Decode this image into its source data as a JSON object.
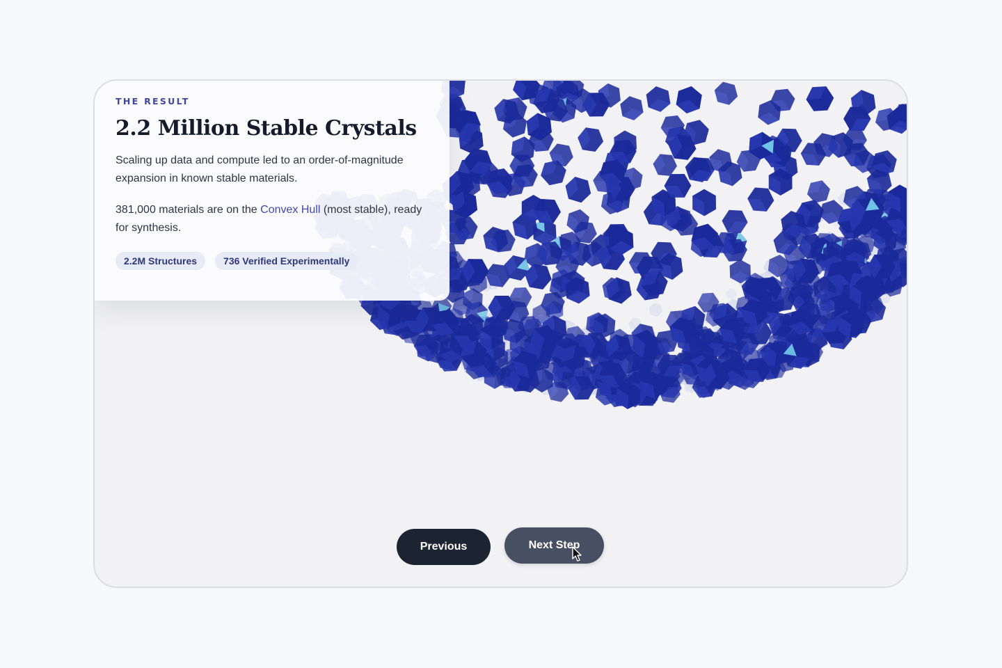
{
  "card": {
    "eyebrow": "THE RESULT",
    "title": "2.2 Million Stable Crystals",
    "paragraph1": "Scaling up data and compute led to an order-of-magnitude expansion in known stable materials.",
    "paragraph2_before": "381,000 materials are on the ",
    "paragraph2_link": "Convex Hull",
    "paragraph2_after": " (most stable), ready for synthesis.",
    "tags": [
      "2.2M Structures",
      "736 Verified Experimentally"
    ]
  },
  "controls": {
    "previous_label": "Previous",
    "next_label": "Next Step"
  },
  "colors": {
    "accent": "#3d46b1",
    "crystal": "#1b2a9a",
    "crystal_highlight": "#6fc3e6",
    "button_dark": "#1d2431",
    "button_active": "#475062"
  },
  "icons": {
    "crystal": "crystal-icon",
    "cursor": "mouse-pointer-icon"
  }
}
